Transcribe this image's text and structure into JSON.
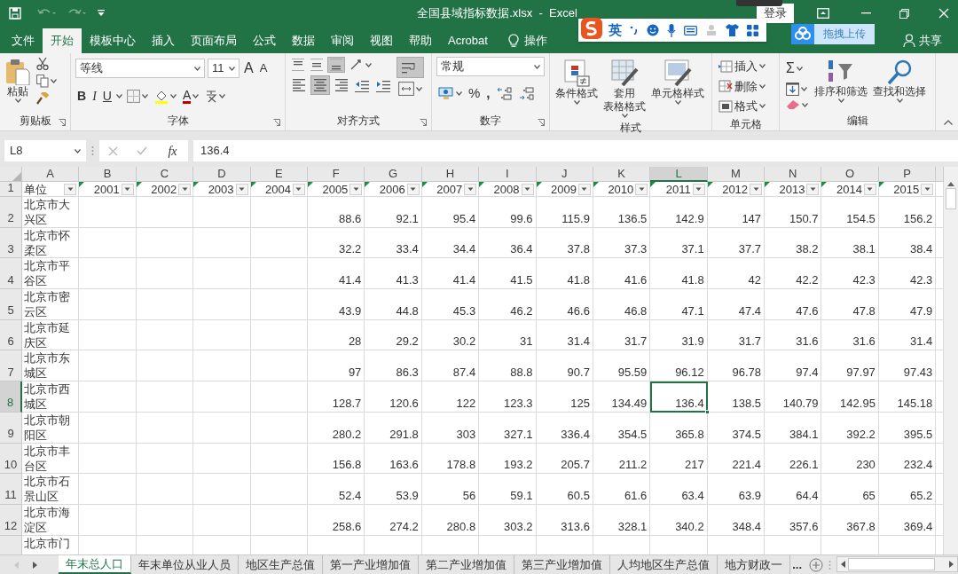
{
  "window": {
    "title": "全国县域指标数据.xlsx  -  Excel",
    "login": "登录"
  },
  "menu_tabs": [
    {
      "label": "文件",
      "selected": false
    },
    {
      "label": "开始",
      "selected": true
    },
    {
      "label": "模板中心",
      "selected": false
    },
    {
      "label": "插入",
      "selected": false
    },
    {
      "label": "页面布局",
      "selected": false
    },
    {
      "label": "公式",
      "selected": false
    },
    {
      "label": "数据",
      "selected": false
    },
    {
      "label": "审阅",
      "selected": false
    },
    {
      "label": "视图",
      "selected": false
    },
    {
      "label": "帮助",
      "selected": false
    },
    {
      "label": "Acrobat",
      "selected": false
    }
  ],
  "tell_me": "操作",
  "ime_toolbar": {
    "mode": "英"
  },
  "cloud_upload": "拖拽上传",
  "share": "共享",
  "ribbon": [
    {
      "kind": "clipboard",
      "label": "剪贴板",
      "paste": "粘贴"
    },
    {
      "kind": "font",
      "label": "字体",
      "font_name": "等线",
      "font_size": "11",
      "grow": "A",
      "shrink": "A",
      "styles": [
        "B",
        "I",
        "U"
      ],
      "color_letter": "A"
    },
    {
      "kind": "alignment",
      "label": "对齐方式",
      "vertical_buttons": [
        {
          "kind": "top",
          "selected": false
        },
        {
          "kind": "middle",
          "selected": false
        },
        {
          "kind": "bottom",
          "selected": true
        }
      ],
      "horizontal_buttons": [
        {
          "kind": "left",
          "selected": false
        },
        {
          "kind": "center",
          "selected": true
        },
        {
          "kind": "right",
          "selected": false
        }
      ],
      "wrap_text": true
    },
    {
      "kind": "number",
      "label": "数字",
      "format": "常规",
      "symbols": [
        "%",
        ","
      ]
    },
    {
      "kind": "styles",
      "label": "样式",
      "buttons": [
        {
          "lines": [
            "条件格式"
          ]
        },
        {
          "lines": [
            "套用",
            "表格格式"
          ]
        },
        {
          "lines": [
            "单元格样式"
          ]
        }
      ]
    },
    {
      "kind": "cells",
      "label": "单元格",
      "buttons": [
        "插入",
        "删除",
        "格式"
      ]
    },
    {
      "kind": "editing",
      "label": "编辑",
      "sum": "Σ",
      "buttons": [
        "排序和筛选",
        "查找和选择"
      ]
    }
  ],
  "formula_bar": {
    "name_box": "L8",
    "fx": "fx",
    "value": "136.4"
  },
  "columns": [
    {
      "label": "A",
      "selected": false
    },
    {
      "label": "B",
      "selected": false
    },
    {
      "label": "C",
      "selected": false
    },
    {
      "label": "D",
      "selected": false
    },
    {
      "label": "E",
      "selected": false
    },
    {
      "label": "F",
      "selected": false
    },
    {
      "label": "G",
      "selected": false
    },
    {
      "label": "H",
      "selected": false
    },
    {
      "label": "I",
      "selected": false
    },
    {
      "label": "J",
      "selected": false
    },
    {
      "label": "K",
      "selected": false
    },
    {
      "label": "L",
      "selected": true
    },
    {
      "label": "M",
      "selected": false
    },
    {
      "label": "N",
      "selected": false
    },
    {
      "label": "O",
      "selected": false
    },
    {
      "label": "P",
      "selected": false
    }
  ],
  "header_row": {
    "number": "1",
    "filter": true,
    "cells": [
      {
        "text": "单位",
        "marker": false
      },
      {
        "text": "2001",
        "marker": true
      },
      {
        "text": "2002",
        "marker": true
      },
      {
        "text": "2003",
        "marker": true
      },
      {
        "text": "2004",
        "marker": true
      },
      {
        "text": "2005",
        "marker": true
      },
      {
        "text": "2006",
        "marker": true
      },
      {
        "text": "2007",
        "marker": true
      },
      {
        "text": "2008",
        "marker": true
      },
      {
        "text": "2009",
        "marker": true
      },
      {
        "text": "2010",
        "marker": true
      },
      {
        "text": "2011",
        "marker": true
      },
      {
        "text": "2012",
        "marker": true
      },
      {
        "text": "2013",
        "marker": true
      },
      {
        "text": "2014",
        "marker": true
      },
      {
        "text": "2015",
        "marker": true
      }
    ]
  },
  "rows": [
    {
      "number": "2",
      "label": "北京市大兴区",
      "selected": false,
      "values": [
        "88.6",
        "92.1",
        "95.4",
        "99.6",
        "115.9",
        "136.5",
        "142.9",
        "147",
        "150.7",
        "154.5",
        "156.2"
      ]
    },
    {
      "number": "3",
      "label": "北京市怀柔区",
      "selected": false,
      "values": [
        "32.2",
        "33.4",
        "34.4",
        "36.4",
        "37.8",
        "37.3",
        "37.1",
        "37.7",
        "38.2",
        "38.1",
        "38.4"
      ]
    },
    {
      "number": "4",
      "label": "北京市平谷区",
      "selected": false,
      "values": [
        "41.4",
        "41.3",
        "41.4",
        "41.5",
        "41.8",
        "41.6",
        "41.8",
        "42",
        "42.2",
        "42.3",
        "42.3"
      ]
    },
    {
      "number": "5",
      "label": "北京市密云区",
      "selected": false,
      "values": [
        "43.9",
        "44.8",
        "45.3",
        "46.2",
        "46.6",
        "46.8",
        "47.1",
        "47.4",
        "47.6",
        "47.8",
        "47.9"
      ]
    },
    {
      "number": "6",
      "label": "北京市延庆区",
      "selected": false,
      "values": [
        "28",
        "29.2",
        "30.2",
        "31",
        "31.4",
        "31.7",
        "31.9",
        "31.7",
        "31.6",
        "31.6",
        "31.4"
      ]
    },
    {
      "number": "7",
      "label": "北京市东城区",
      "selected": false,
      "values": [
        "97",
        "86.3",
        "87.4",
        "88.8",
        "90.7",
        "95.59",
        "96.12",
        "96.78",
        "97.4",
        "97.97",
        "97.43"
      ]
    },
    {
      "number": "8",
      "label": "北京市西城区",
      "selected": true,
      "values": [
        "128.7",
        "120.6",
        "122",
        "123.3",
        "125",
        "134.49",
        "136.4",
        "138.5",
        "140.79",
        "142.95",
        "145.18"
      ]
    },
    {
      "number": "9",
      "label": "北京市朝阳区",
      "selected": false,
      "values": [
        "280.2",
        "291.8",
        "303",
        "327.1",
        "336.4",
        "354.5",
        "365.8",
        "374.5",
        "384.1",
        "392.2",
        "395.5"
      ]
    },
    {
      "number": "10",
      "label": "北京市丰台区",
      "selected": false,
      "values": [
        "156.8",
        "163.6",
        "178.8",
        "193.2",
        "205.7",
        "211.2",
        "217",
        "221.4",
        "226.1",
        "230",
        "232.4"
      ]
    },
    {
      "number": "11",
      "label": "北京市石景山区",
      "selected": false,
      "values": [
        "52.4",
        "53.9",
        "56",
        "59.1",
        "60.5",
        "61.6",
        "63.4",
        "63.9",
        "64.4",
        "65",
        "65.2"
      ]
    },
    {
      "number": "12",
      "label": "北京市海淀区",
      "selected": false,
      "values": [
        "258.6",
        "274.2",
        "280.8",
        "303.2",
        "313.6",
        "328.1",
        "340.2",
        "348.4",
        "357.6",
        "367.8",
        "369.4"
      ]
    },
    {
      "label": "北京市门",
      "selected": false
    }
  ],
  "sheet_tabs": [
    {
      "label": "年末总人口",
      "selected": true
    },
    {
      "label": "年末单位从业人员",
      "selected": false
    },
    {
      "label": "地区生产总值",
      "selected": false
    },
    {
      "label": "第一产业增加值",
      "selected": false
    },
    {
      "label": "第二产业增加值",
      "selected": false
    },
    {
      "label": "第三产业增加值",
      "selected": false
    },
    {
      "label": "人均地区生产总值",
      "selected": false
    },
    {
      "label": "地方财政一",
      "selected": false
    }
  ],
  "sheet_tabs_more": "..."
}
